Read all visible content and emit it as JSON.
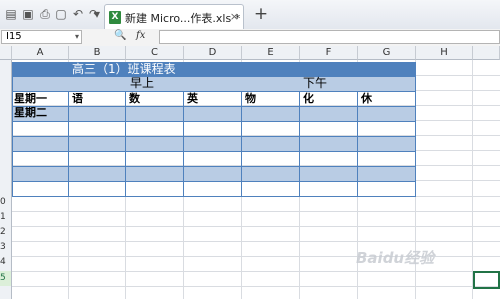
{
  "window": {
    "tab_label": "新建 Micro...作表.xls *",
    "tab_close": "×",
    "new_tab": "+"
  },
  "toolbar": {
    "icons": [
      "menu-icon",
      "save-icon",
      "print-icon",
      "print-preview-icon",
      "undo-icon",
      "redo-icon",
      "dropdown-icon"
    ],
    "menu_glyph": "▤",
    "save_glyph": "▣",
    "print_glyph": "⎙",
    "preview_glyph": "▢",
    "undo_glyph": "↶",
    "redo_glyph": "↷",
    "dropdown_glyph": "▾"
  },
  "formula_bar": {
    "name_box": "I15",
    "name_arrow": "▾",
    "zoom_glyph": "🔍",
    "fx_label": "fx",
    "formula_value": ""
  },
  "columns": [
    "A",
    "B",
    "C",
    "D",
    "E",
    "F",
    "G",
    "H"
  ],
  "row_headers": [
    "",
    "",
    "",
    "",
    "",
    "",
    "",
    "",
    "",
    "0",
    "1",
    "2",
    "3",
    "4",
    "5"
  ],
  "sheet": {
    "title": "高三（1）班课程表",
    "morning": "早上",
    "afternoon": "下午",
    "row1_label": "星期一",
    "row2_label": "星期二",
    "subjects": [
      "语",
      "数",
      "英",
      "物",
      "化",
      "休"
    ]
  },
  "watermark": "Baidu经验",
  "colors": {
    "title_band": "#4f81bd",
    "row_band": "#b9cce4",
    "selection": "#217346"
  }
}
